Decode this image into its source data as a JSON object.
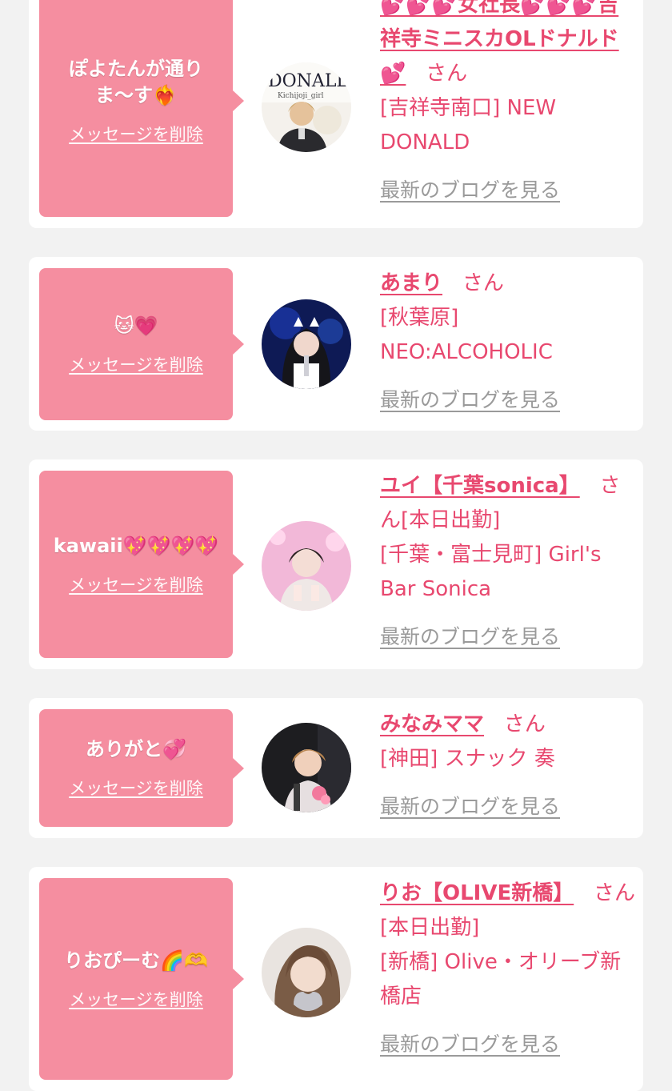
{
  "cards": [
    {
      "message": "ぽよたんが通りま〜す❤️‍🔥",
      "delete_label": "メッセージを削除",
      "name": "💕💕💕女社長💕💕💕吉祥寺ミニスカOLドナルド💕",
      "san": "さん",
      "status": "",
      "shop": "[吉祥寺南口] NEW DONALD",
      "blog_label": "最新のブログを見る"
    },
    {
      "message": "🐱💗",
      "delete_label": "メッセージを削除",
      "name": "あまり",
      "san": "さん",
      "status": "",
      "shop": "[秋葉原] NEO:ALCOHOLIC",
      "blog_label": "最新のブログを見る"
    },
    {
      "message": "kawaii💖💖💖💖",
      "delete_label": "メッセージを削除",
      "name": "ユイ【千葉sonica】",
      "san": "さん",
      "status": "[本日出勤]",
      "shop": "[千葉・富士見町] Girl's Bar Sonica",
      "blog_label": "最新のブログを見る"
    },
    {
      "message": "ありがと💞",
      "delete_label": "メッセージを削除",
      "name": "みなみママ",
      "san": "さん",
      "status": "",
      "shop": "[神田] スナック 奏",
      "blog_label": "最新のブログを見る"
    },
    {
      "message": "りおぴーむ🌈🫶",
      "delete_label": "メッセージを削除",
      "name": "りお【OLIVE新橋】",
      "san": "さん",
      "status": "[本日出勤]",
      "shop": "[新橋] Olive・オリーブ新橋店",
      "blog_label": "最新のブログを見る"
    }
  ],
  "colors": {
    "bubble": "#f58ea0",
    "name": "#e8486f",
    "blog_link": "#9a9a9a",
    "background": "#f2f2f2"
  },
  "icons": [
    "cat-emoji",
    "heart-emoji",
    "sparkle-heart-emoji",
    "rainbow-emoji",
    "heart-hands-emoji"
  ]
}
